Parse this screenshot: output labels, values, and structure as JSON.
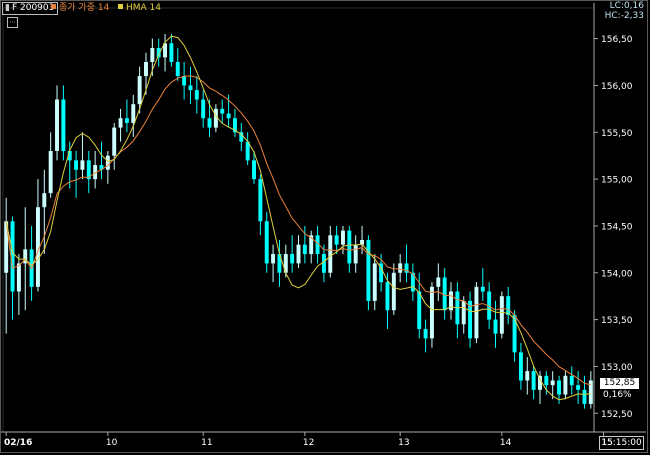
{
  "header": {
    "symbol": "F 200903",
    "indicator1": "종가 가중 14",
    "indicator2": "HMA 14",
    "lc": "LC:0,16",
    "hc": "HC:-2,33"
  },
  "colors": {
    "background": "#000000",
    "up": "#ccffff",
    "down": "#00ffff",
    "wma_line": "#e8823c",
    "hma_line": "#e0d040",
    "axis_text": "#ffffff"
  },
  "icons": [
    "tool-icon"
  ],
  "price_marker": {
    "value": "152,85",
    "change": "0,16%"
  },
  "time_label": "15:15:00",
  "chart_data": {
    "type": "candlestick",
    "title": "",
    "xlabel": "",
    "ylabel": "",
    "ylim": [
      152.3,
      156.72
    ],
    "yticks": [
      "156,50",
      "156,00",
      "155,50",
      "155,00",
      "154,50",
      "154,00",
      "153,50",
      "153,00",
      "152,50"
    ],
    "ytick_values": [
      156.5,
      156.0,
      155.5,
      155.0,
      154.5,
      154.0,
      153.5,
      153.0,
      152.5
    ],
    "xticks": [
      "02/16",
      "10",
      "11",
      "12",
      "13",
      "14",
      "15"
    ],
    "xtick_index": [
      0,
      16,
      31,
      47,
      62,
      78,
      94
    ],
    "ohlc": [
      [
        154.0,
        154.8,
        153.35,
        154.55
      ],
      [
        154.55,
        154.6,
        153.5,
        153.8
      ],
      [
        153.8,
        154.2,
        153.55,
        154.1
      ],
      [
        154.1,
        154.7,
        153.6,
        154.25
      ],
      [
        154.25,
        154.5,
        153.7,
        153.85
      ],
      [
        153.85,
        155.0,
        153.8,
        154.7
      ],
      [
        154.7,
        155.1,
        154.2,
        154.85
      ],
      [
        154.85,
        155.5,
        154.8,
        155.3
      ],
      [
        155.3,
        156.0,
        155.2,
        155.85
      ],
      [
        155.85,
        156.0,
        155.2,
        155.3
      ],
      [
        155.3,
        155.4,
        154.9,
        155.2
      ],
      [
        155.2,
        155.3,
        154.8,
        155.1
      ],
      [
        155.1,
        155.5,
        155.0,
        155.2
      ],
      [
        155.2,
        155.3,
        154.85,
        155.0
      ],
      [
        155.0,
        155.3,
        154.9,
        155.15
      ],
      [
        155.15,
        155.4,
        155.0,
        155.1
      ],
      [
        155.1,
        155.3,
        154.95,
        155.25
      ],
      [
        155.25,
        155.6,
        155.1,
        155.55
      ],
      [
        155.55,
        155.75,
        155.4,
        155.65
      ],
      [
        155.65,
        155.85,
        155.5,
        155.6
      ],
      [
        155.6,
        155.9,
        155.45,
        155.8
      ],
      [
        155.8,
        156.2,
        155.7,
        156.1
      ],
      [
        156.1,
        156.35,
        155.9,
        156.25
      ],
      [
        156.25,
        156.5,
        156.1,
        156.4
      ],
      [
        156.4,
        156.5,
        156.2,
        156.3
      ],
      [
        156.3,
        156.55,
        156.15,
        156.45
      ],
      [
        156.45,
        156.55,
        156.2,
        156.25
      ],
      [
        156.25,
        156.4,
        156.05,
        156.1
      ],
      [
        156.1,
        156.25,
        155.85,
        156.0
      ],
      [
        156.0,
        156.2,
        155.8,
        155.95
      ],
      [
        155.95,
        156.1,
        155.7,
        155.85
      ],
      [
        155.85,
        155.95,
        155.55,
        155.65
      ],
      [
        155.65,
        155.85,
        155.45,
        155.55
      ],
      [
        155.55,
        155.8,
        155.5,
        155.75
      ],
      [
        155.75,
        155.85,
        155.6,
        155.7
      ],
      [
        155.7,
        155.9,
        155.55,
        155.65
      ],
      [
        155.65,
        155.75,
        155.45,
        155.5
      ],
      [
        155.5,
        155.6,
        155.3,
        155.4
      ],
      [
        155.4,
        155.5,
        155.15,
        155.2
      ],
      [
        155.2,
        155.3,
        154.95,
        155.0
      ],
      [
        155.0,
        155.05,
        154.4,
        154.55
      ],
      [
        154.55,
        154.65,
        154.0,
        154.1
      ],
      [
        154.1,
        154.3,
        153.9,
        154.2
      ],
      [
        154.2,
        154.35,
        153.85,
        154.0
      ],
      [
        154.0,
        154.3,
        153.95,
        154.2
      ],
      [
        154.2,
        154.4,
        154.0,
        154.1
      ],
      [
        154.1,
        154.4,
        154.05,
        154.3
      ],
      [
        154.3,
        154.5,
        154.1,
        154.2
      ],
      [
        154.2,
        154.45,
        154.1,
        154.4
      ],
      [
        154.4,
        154.5,
        154.1,
        154.2
      ],
      [
        154.2,
        154.3,
        153.9,
        154.0
      ],
      [
        154.0,
        154.5,
        153.95,
        154.4
      ],
      [
        154.4,
        154.5,
        154.2,
        154.3
      ],
      [
        154.3,
        154.5,
        154.2,
        154.45
      ],
      [
        154.45,
        154.5,
        154.0,
        154.1
      ],
      [
        154.1,
        154.4,
        154.0,
        154.3
      ],
      [
        154.3,
        154.5,
        154.2,
        154.35
      ],
      [
        154.35,
        154.4,
        153.6,
        153.7
      ],
      [
        153.7,
        154.2,
        153.6,
        154.1
      ],
      [
        154.1,
        154.2,
        153.8,
        153.9
      ],
      [
        153.9,
        154.0,
        153.4,
        153.6
      ],
      [
        153.6,
        154.1,
        153.55,
        154.0
      ],
      [
        154.0,
        154.2,
        153.9,
        154.1
      ],
      [
        154.1,
        154.3,
        153.9,
        154.0
      ],
      [
        154.0,
        154.1,
        153.7,
        153.8
      ],
      [
        153.8,
        154.0,
        153.3,
        153.4
      ],
      [
        153.4,
        153.5,
        153.15,
        153.3
      ],
      [
        153.3,
        153.9,
        153.2,
        153.85
      ],
      [
        153.85,
        154.1,
        153.7,
        153.95
      ],
      [
        153.95,
        154.05,
        153.5,
        153.6
      ],
      [
        153.6,
        153.9,
        153.5,
        153.8
      ],
      [
        153.8,
        153.9,
        153.3,
        153.45
      ],
      [
        153.45,
        153.75,
        153.35,
        153.7
      ],
      [
        153.7,
        153.8,
        153.2,
        153.3
      ],
      [
        153.3,
        153.9,
        153.25,
        153.85
      ],
      [
        153.85,
        154.05,
        153.7,
        153.8
      ],
      [
        153.8,
        153.9,
        153.4,
        153.5
      ],
      [
        153.5,
        153.7,
        153.2,
        153.35
      ],
      [
        153.35,
        153.8,
        153.3,
        153.75
      ],
      [
        153.75,
        153.85,
        153.45,
        153.55
      ],
      [
        153.55,
        153.6,
        153.05,
        153.15
      ],
      [
        153.15,
        153.25,
        152.75,
        152.85
      ],
      [
        152.85,
        153.1,
        152.7,
        152.95
      ],
      [
        152.95,
        153.0,
        152.65,
        152.75
      ],
      [
        152.75,
        152.95,
        152.6,
        152.9
      ],
      [
        152.9,
        152.95,
        152.7,
        152.8
      ],
      [
        152.8,
        152.95,
        152.65,
        152.85
      ],
      [
        152.85,
        152.9,
        152.6,
        152.7
      ],
      [
        152.7,
        152.95,
        152.65,
        152.9
      ],
      [
        152.9,
        153.0,
        152.7,
        152.8
      ],
      [
        152.8,
        152.95,
        152.6,
        152.75
      ],
      [
        152.75,
        152.9,
        152.55,
        152.6
      ],
      [
        152.6,
        152.95,
        152.55,
        152.85
      ]
    ]
  }
}
